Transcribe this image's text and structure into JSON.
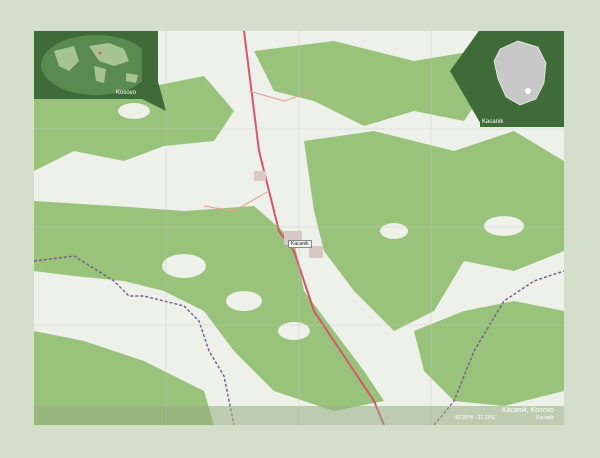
{
  "map": {
    "city_label": "Kacanik",
    "caption_title": "Kacanik, Kosovo",
    "caption_coords": "42.20°N · 21.23°E",
    "caption_source": "Kacanik"
  },
  "insets": {
    "world_label": "Kosovo",
    "kosovo_label": "Kacanik",
    "kosovo_vertical": "Kosovo"
  },
  "colors": {
    "forest": "#99c27a",
    "open": "#eef0ea",
    "road": "#d7566d",
    "border": "#7a5a8a",
    "inset_bg": "#3f6b38",
    "frame": "#d3dfcb"
  }
}
